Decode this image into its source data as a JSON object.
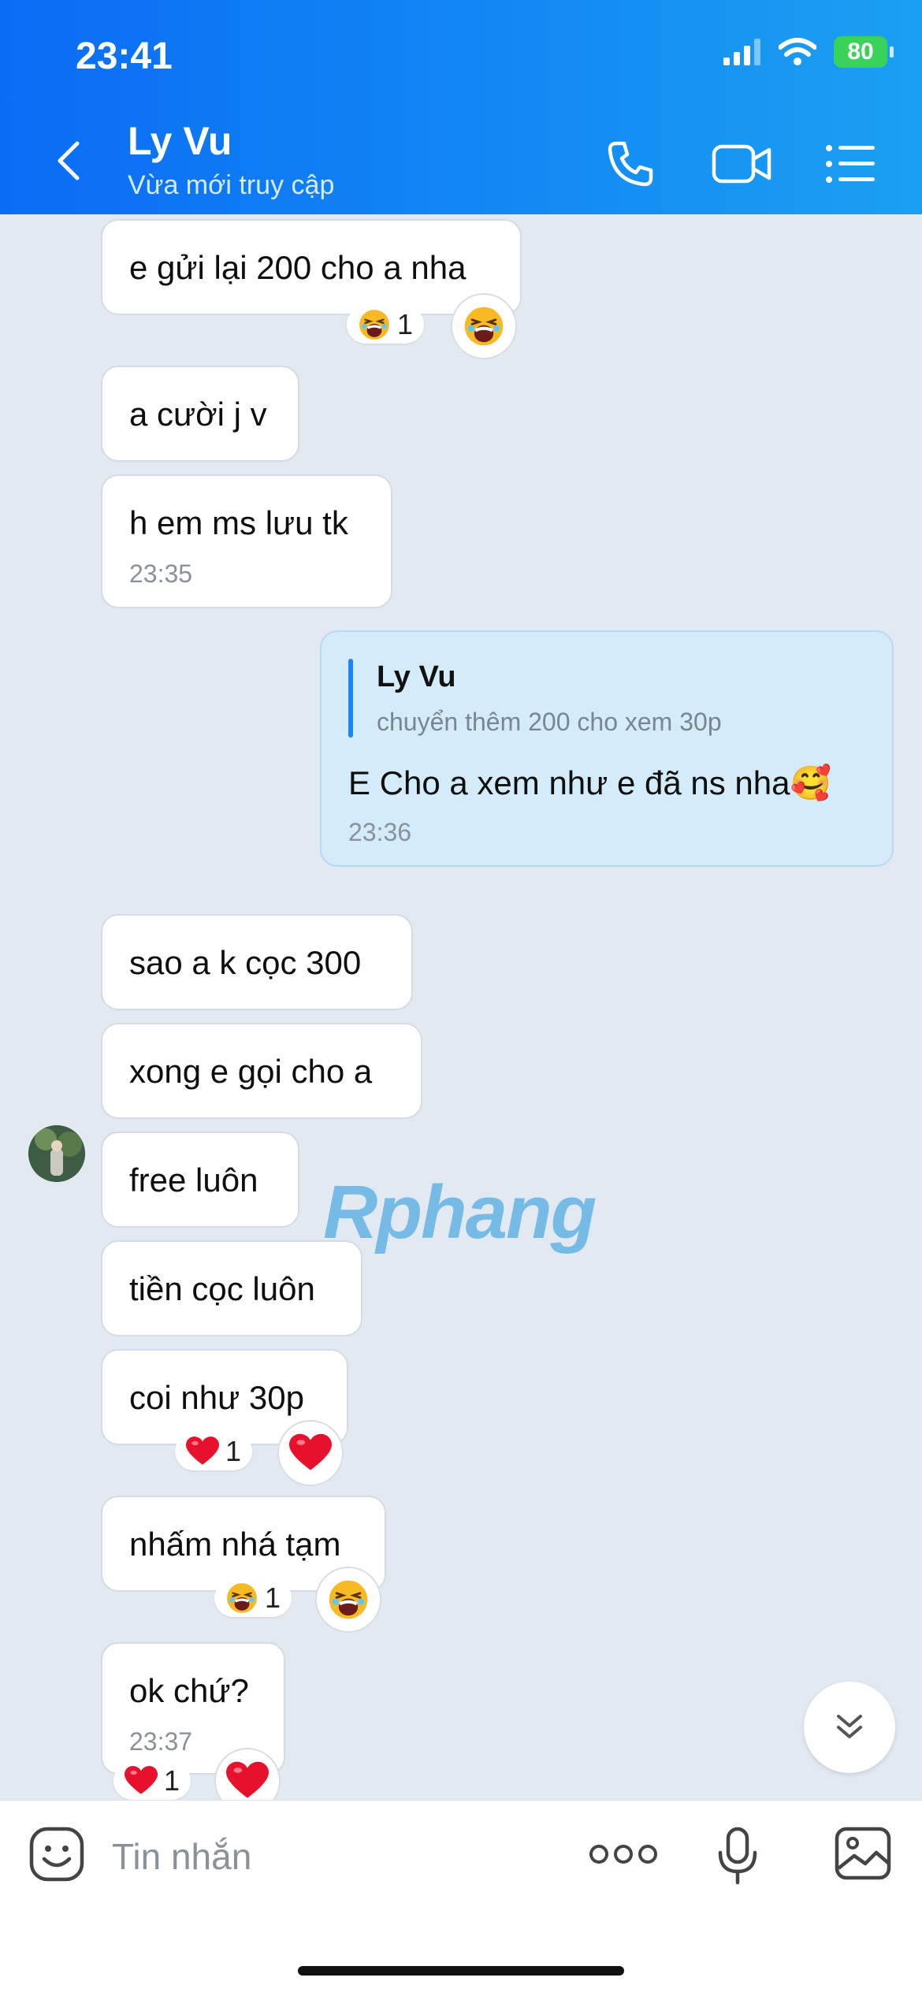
{
  "status_bar": {
    "time": "23:41",
    "battery": "80"
  },
  "header": {
    "name": "Ly Vu",
    "status": "Vừa mới truy cập"
  },
  "messages": [
    {
      "text": "e gửi lại 200 cho a nha",
      "reaction_count": "1"
    },
    {
      "text": "a cười j v"
    },
    {
      "text": "h em ms lưu tk",
      "time": "23:35"
    },
    {
      "quote_name": "Ly Vu",
      "quote_text": "chuyển thêm 200 cho xem 30p",
      "text": "E Cho a xem như e đã ns nha",
      "emoji": "🥰",
      "time": "23:36"
    },
    {
      "text": "sao a k cọc 300"
    },
    {
      "text": "xong e gọi cho a"
    },
    {
      "text": "free luôn"
    },
    {
      "text": "tiền cọc luôn"
    },
    {
      "text": "coi như 30p",
      "reaction_count": "1"
    },
    {
      "text": "nhấm nhá tạm",
      "reaction_count": "1"
    },
    {
      "text": "ok chứ?",
      "time": "23:37",
      "reaction_count": "1"
    }
  ],
  "watermark": {
    "part1": "R",
    "part2": "phang"
  },
  "composer": {
    "placeholder": "Tin nhắn"
  },
  "colors": {
    "header_start": "#0a6cf5",
    "header_end": "#1aa0f2",
    "outgoing_bubble": "#d4ecfa",
    "chat_bg": "#e2e9f1"
  }
}
